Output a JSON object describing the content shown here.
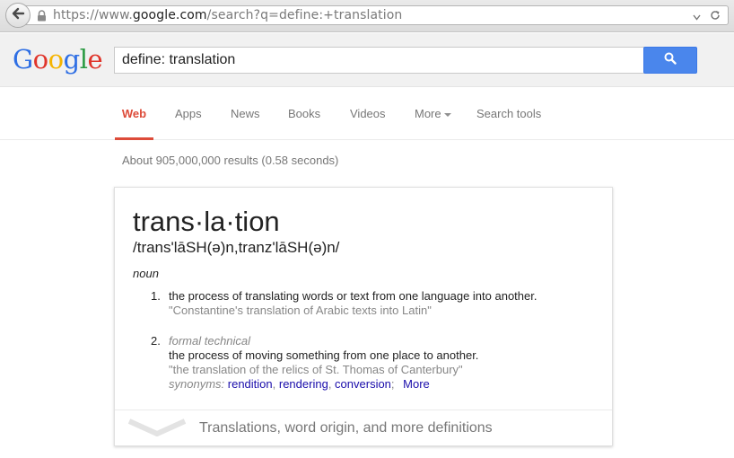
{
  "browser": {
    "url_prefix": "https://www.",
    "url_host": "google.com",
    "url_path": "/search?q=define:+translation"
  },
  "header": {
    "logo_letters": [
      "G",
      "o",
      "o",
      "g",
      "l",
      "e"
    ],
    "search_value": "define: translation"
  },
  "nav": {
    "tabs": [
      {
        "label": "Web",
        "active": true
      },
      {
        "label": "Apps"
      },
      {
        "label": "News"
      },
      {
        "label": "Books"
      },
      {
        "label": "Videos"
      },
      {
        "label": "More"
      },
      {
        "label": "Search tools"
      }
    ]
  },
  "stats": "About 905,000,000 results (0.58 seconds)",
  "card": {
    "word": "trans·la·tion",
    "pronunciation": "/trans'lāSH(ə)n,tranz'lāSH(ə)n/",
    "part_of_speech": "noun",
    "definitions": [
      {
        "num": "1.",
        "text": "the process of translating words or text from one language into another.",
        "example": "\"Constantine's translation of Arabic texts into Latin\""
      },
      {
        "num": "2.",
        "labels": "formal technical",
        "text": "the process of moving something from one place to another.",
        "example": "\"the translation of the relics of St. Thomas of Canterbury\"",
        "synonyms_label": "synonyms:",
        "synonyms": [
          "rendition",
          "rendering",
          "conversion"
        ],
        "more": "More"
      }
    ],
    "footer_text": "Translations, word origin, and more definitions"
  }
}
